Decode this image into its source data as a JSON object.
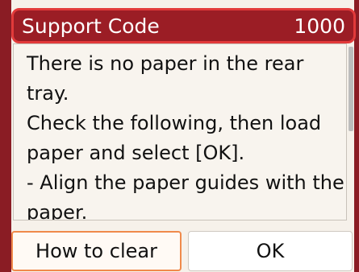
{
  "header": {
    "title": "Support Code",
    "code": "1000"
  },
  "message": {
    "lines": [
      "There is no paper in the rear",
      "tray.",
      "Check the following, then load",
      "paper and select [OK].",
      "- Align the paper guides with the",
      "paper."
    ]
  },
  "buttons": {
    "how_to_clear": "How to clear",
    "ok": "OK"
  },
  "colors": {
    "header_bg": "#9b1d25",
    "header_border": "#e23a3a",
    "focus_border": "#f08a4b",
    "side_frame": "#8a1c24"
  }
}
